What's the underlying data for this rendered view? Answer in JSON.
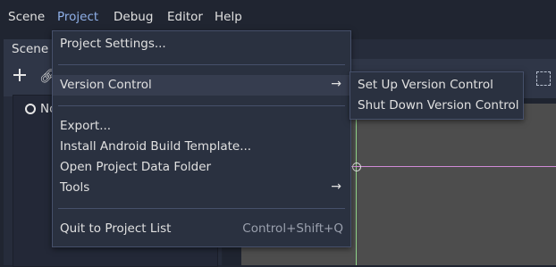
{
  "menubar": {
    "items": [
      {
        "label": "Scene"
      },
      {
        "label": "Project"
      },
      {
        "label": "Debug"
      },
      {
        "label": "Editor"
      },
      {
        "label": "Help"
      }
    ],
    "active": "Project"
  },
  "scene_dock": {
    "tab_label": "Scene",
    "node_label": "No"
  },
  "project_menu": {
    "items": [
      {
        "label": "Project Settings..."
      },
      {
        "label": "Version Control",
        "has_submenu": true
      },
      {
        "label": "Export..."
      },
      {
        "label": "Install Android Build Template..."
      },
      {
        "label": "Open Project Data Folder"
      },
      {
        "label": "Tools",
        "has_submenu": true
      },
      {
        "label": "Quit to Project List",
        "shortcut": "Control+Shift+Q"
      }
    ]
  },
  "version_control_submenu": {
    "items": [
      {
        "label": "Set Up Version Control"
      },
      {
        "label": "Shut Down Version Control"
      }
    ]
  },
  "colors": {
    "background": "#202531",
    "panel": "#2f3647",
    "menu": "#2a3140",
    "active_menu_text": "#8fb0e8",
    "viewport": "#4d4d4d"
  },
  "icons": [
    "plus-icon",
    "link-icon",
    "node-icon",
    "chevron-right-icon",
    "grid-icon",
    "origin-icon"
  ]
}
